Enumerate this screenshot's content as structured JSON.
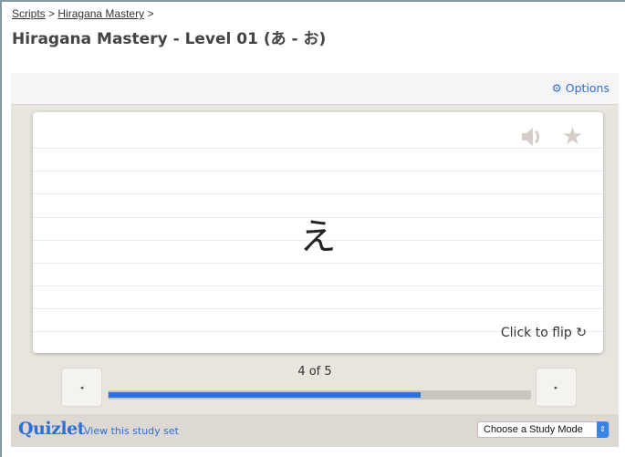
{
  "breadcrumb": {
    "items": [
      "Scripts",
      "Hiragana Mastery"
    ],
    "separator": ">"
  },
  "page_title": "Hiragana Mastery - Level 01 (あ - お)",
  "options": {
    "label": "Options",
    "icon": "gear-icon"
  },
  "card": {
    "term": "え",
    "flip_label": "Click to flip",
    "icons": [
      "speaker-icon",
      "star-icon",
      "refresh-icon"
    ]
  },
  "nav": {
    "prev": "◂",
    "next": "▸",
    "counter": "4 of 5",
    "progress_percent": 80
  },
  "footer": {
    "logo": "Quizlet",
    "view_link": "View this study set",
    "study_mode": "Choose a Study Mode"
  },
  "colors": {
    "accent": "#2a73d8",
    "frame": "#e8e4de"
  }
}
